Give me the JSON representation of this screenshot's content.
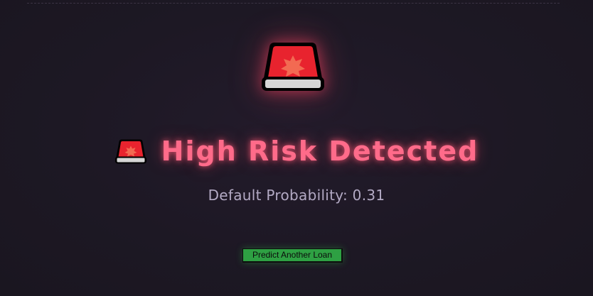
{
  "result": {
    "icon": "police-car-light-icon",
    "title": "High Risk Detected",
    "probability_text": "Default Probability: 0.31",
    "accent_color": "#ff6b8a"
  },
  "actions": {
    "predict_another_label": "Predict Another Loan",
    "button_color": "#2ea043"
  }
}
